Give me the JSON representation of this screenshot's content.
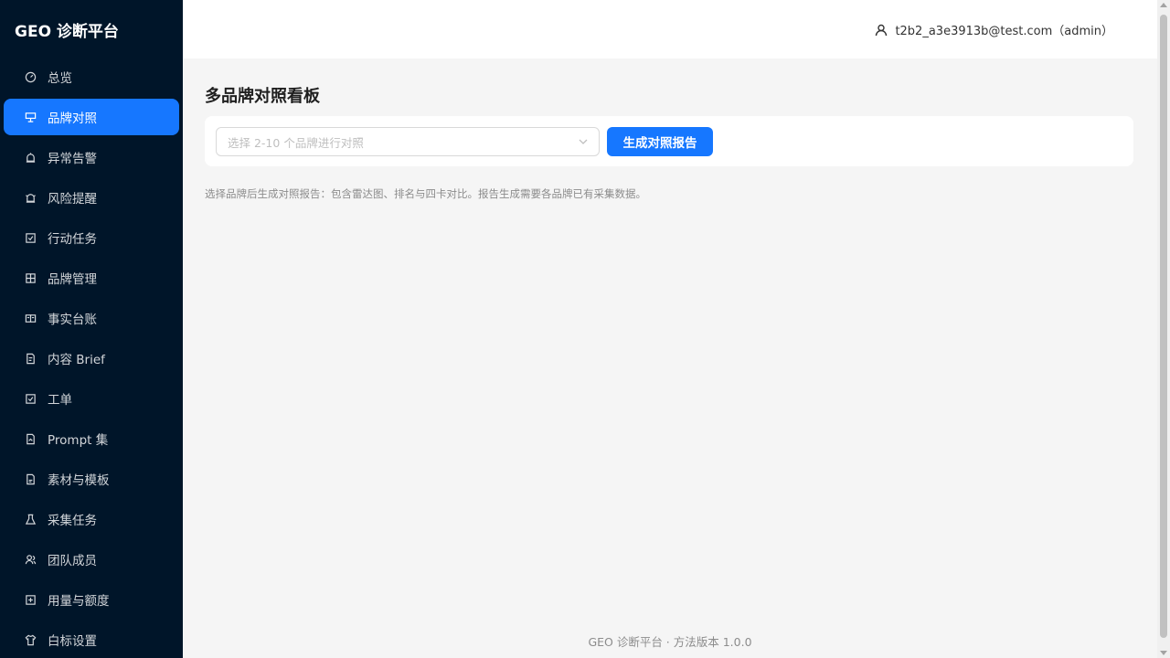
{
  "app": {
    "title": "GEO 诊断平台"
  },
  "sidebar": {
    "items": [
      {
        "label": "总览",
        "icon": "dashboard-icon",
        "active": false
      },
      {
        "label": "品牌对照",
        "icon": "compare-icon",
        "active": true
      },
      {
        "label": "异常告警",
        "icon": "alert-icon",
        "active": false
      },
      {
        "label": "风险提醒",
        "icon": "warning-icon",
        "active": false
      },
      {
        "label": "行动任务",
        "icon": "checkbox-icon",
        "active": false
      },
      {
        "label": "品牌管理",
        "icon": "grid-icon",
        "active": false
      },
      {
        "label": "事实台账",
        "icon": "ledger-icon",
        "active": false
      },
      {
        "label": "内容 Brief",
        "icon": "brief-icon",
        "active": false
      },
      {
        "label": "工单",
        "icon": "ticket-icon",
        "active": false
      },
      {
        "label": "Prompt 集",
        "icon": "document-icon",
        "active": false
      },
      {
        "label": "素材与模板",
        "icon": "file-icon",
        "active": false
      },
      {
        "label": "采集任务",
        "icon": "flask-icon",
        "active": false
      },
      {
        "label": "团队成员",
        "icon": "team-icon",
        "active": false
      },
      {
        "label": "用量与额度",
        "icon": "quota-icon",
        "active": false
      },
      {
        "label": "白标设置",
        "icon": "skin-icon",
        "active": false
      }
    ]
  },
  "header": {
    "user": "t2b2_a3e3913b@test.com（admin）"
  },
  "main": {
    "title": "多品牌对照看板",
    "select_placeholder": "选择 2-10 个品牌进行对照",
    "generate_button": "生成对照报告",
    "hint": "选择品牌后生成对照报告：包含雷达图、排名与四卡对比。报告生成需要各品牌已有采集数据。"
  },
  "footer": {
    "text": "GEO 诊断平台 · 方法版本 1.0.0"
  },
  "colors": {
    "sidebar_bg": "#001529",
    "accent": "#1677ff"
  }
}
